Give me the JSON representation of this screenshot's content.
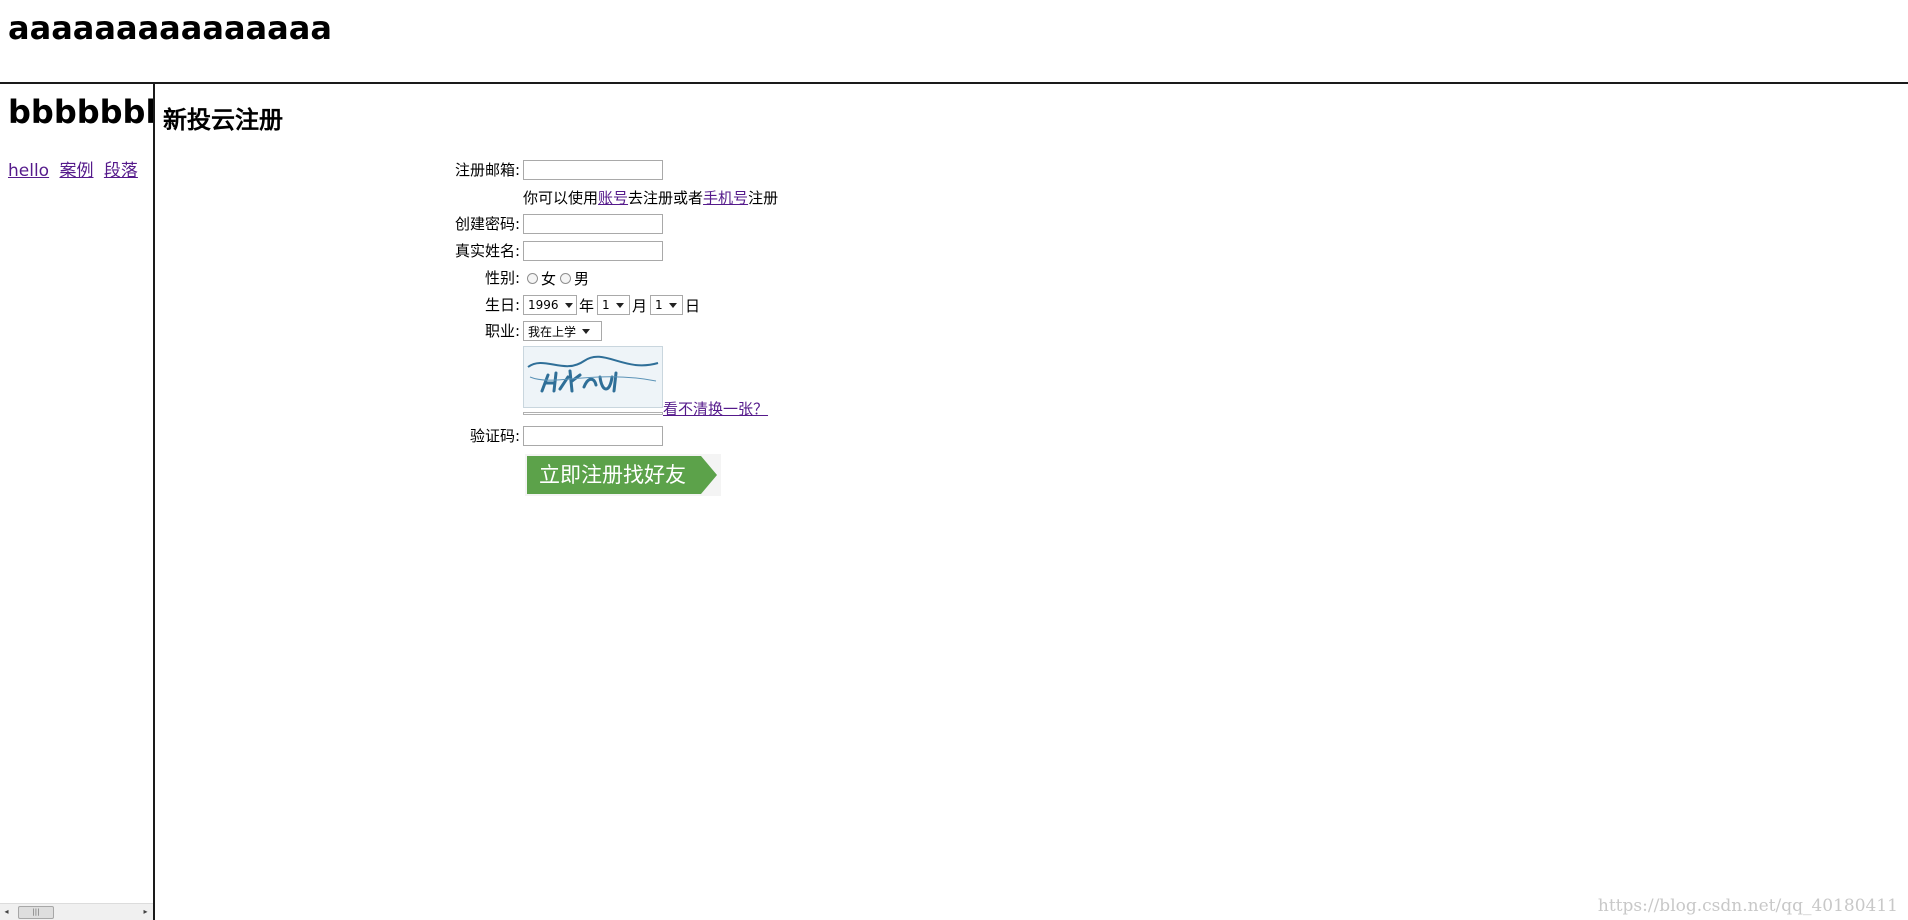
{
  "top_frame": {
    "heading": "aaaaaaaaaaaaaaa"
  },
  "left_frame": {
    "heading": "bbbbbbbbbbbbbbb",
    "links": [
      "hello",
      "案例",
      "段落"
    ]
  },
  "form": {
    "title": "新投云注册",
    "email_label": "注册邮箱:",
    "email_value": "",
    "hint_prefix": "你可以使用",
    "hint_link1": "账号",
    "hint_mid": "去注册或者",
    "hint_link2": "手机号",
    "hint_suffix": "注册",
    "password_label": "创建密码:",
    "password_value": "",
    "name_label": "真实姓名:",
    "name_value": "",
    "gender_label": "性别:",
    "gender_options": [
      "女",
      "男"
    ],
    "birthday_label": "生日:",
    "year_value": "1996",
    "year_unit": "年",
    "month_value": "1",
    "month_unit": "月",
    "day_value": "1",
    "day_unit": "日",
    "job_label": "职业:",
    "job_value": "我在上学",
    "captcha_refresh": "看不清换一张？",
    "captcha_label": "验证码:",
    "captcha_value": "",
    "submit_label": "立即注册找好友"
  },
  "watermark": "https://blog.csdn.net/qq_40180411",
  "colors": {
    "link": "#551a8b",
    "button_green": "#5ca24a",
    "frame_border": "#1a1a1a"
  }
}
